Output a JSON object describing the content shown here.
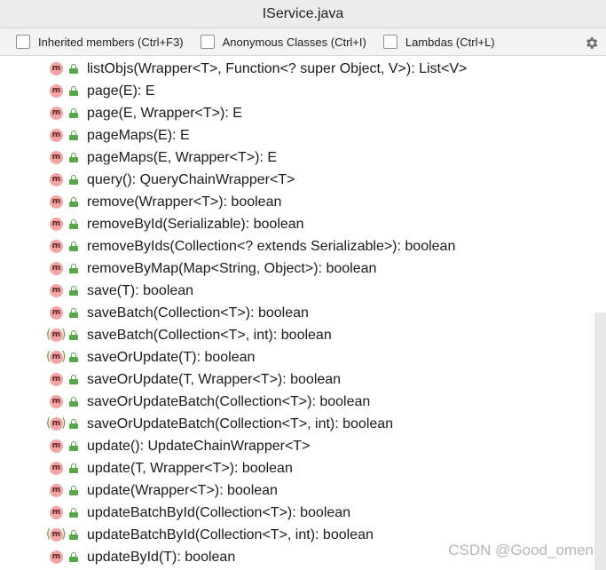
{
  "window": {
    "title": "IService.java"
  },
  "filters": [
    {
      "label": "Inherited members (Ctrl+F3)",
      "checked": false
    },
    {
      "label": "Anonymous Classes (Ctrl+I)",
      "checked": false
    },
    {
      "label": "Lambdas (Ctrl+L)",
      "checked": false
    }
  ],
  "toolbar": {
    "settings_icon": "gear-icon"
  },
  "icons": {
    "method_letter": "m"
  },
  "colors": {
    "method_badge": "#f3a4a4",
    "lock_green": "#57a64a"
  },
  "methods": [
    {
      "signature": "listObjs(Wrapper<T>, Function<? super Object, V>): List<V>",
      "bracketed": false
    },
    {
      "signature": "page(E): E",
      "bracketed": false
    },
    {
      "signature": "page(E, Wrapper<T>): E",
      "bracketed": false
    },
    {
      "signature": "pageMaps(E): E",
      "bracketed": false
    },
    {
      "signature": "pageMaps(E, Wrapper<T>): E",
      "bracketed": false
    },
    {
      "signature": "query(): QueryChainWrapper<T>",
      "bracketed": false
    },
    {
      "signature": "remove(Wrapper<T>): boolean",
      "bracketed": false
    },
    {
      "signature": "removeById(Serializable): boolean",
      "bracketed": false
    },
    {
      "signature": "removeByIds(Collection<? extends Serializable>): boolean",
      "bracketed": false
    },
    {
      "signature": "removeByMap(Map<String, Object>): boolean",
      "bracketed": false
    },
    {
      "signature": "save(T): boolean",
      "bracketed": false
    },
    {
      "signature": "saveBatch(Collection<T>): boolean",
      "bracketed": false
    },
    {
      "signature": "saveBatch(Collection<T>, int): boolean",
      "bracketed": true
    },
    {
      "signature": "saveOrUpdate(T): boolean",
      "bracketed": true
    },
    {
      "signature": "saveOrUpdate(T, Wrapper<T>): boolean",
      "bracketed": false
    },
    {
      "signature": "saveOrUpdateBatch(Collection<T>): boolean",
      "bracketed": false
    },
    {
      "signature": "saveOrUpdateBatch(Collection<T>, int): boolean",
      "bracketed": true
    },
    {
      "signature": "update(): UpdateChainWrapper<T>",
      "bracketed": false
    },
    {
      "signature": "update(T, Wrapper<T>): boolean",
      "bracketed": false
    },
    {
      "signature": "update(Wrapper<T>): boolean",
      "bracketed": false
    },
    {
      "signature": "updateBatchById(Collection<T>): boolean",
      "bracketed": false
    },
    {
      "signature": "updateBatchById(Collection<T>, int): boolean",
      "bracketed": true
    },
    {
      "signature": "updateById(T): boolean",
      "bracketed": false
    }
  ],
  "watermark": "CSDN @Good_omen"
}
